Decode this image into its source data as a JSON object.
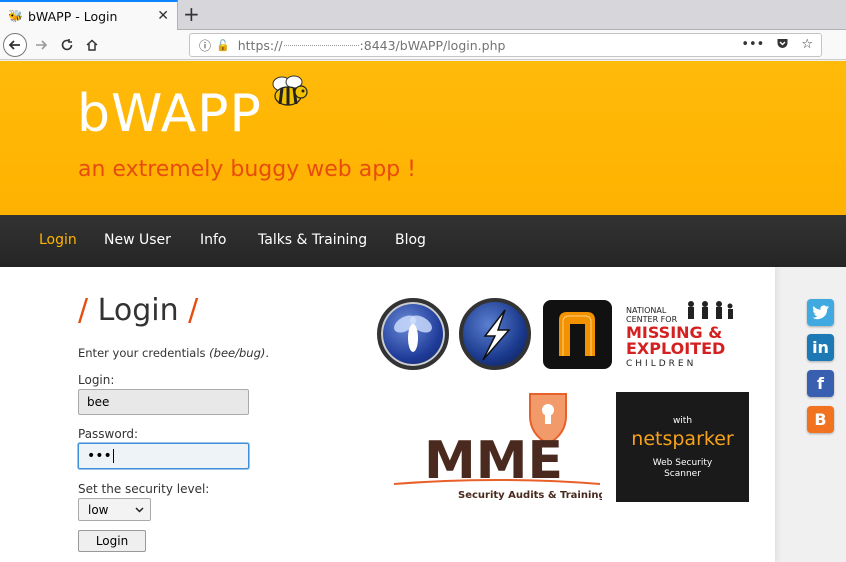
{
  "browser": {
    "tab_title": "bWAPP - Login",
    "url_prefix": "https://",
    "url_suffix": ":8443/bWAPP/login.php"
  },
  "header": {
    "logo": "bWAPP",
    "tagline": "an extremely buggy web app !"
  },
  "menu": [
    {
      "label": "Login",
      "active": true
    },
    {
      "label": "New User",
      "active": false
    },
    {
      "label": "Info",
      "active": false
    },
    {
      "label": "Talks & Training",
      "active": false
    },
    {
      "label": "Blog",
      "active": false
    }
  ],
  "login": {
    "title": "Login",
    "title_slash": "/",
    "credentials_text": "Enter your credentials ",
    "credentials_hint": "(bee/bug)",
    "credentials_end": ".",
    "login_label": "Login:",
    "login_value": "bee",
    "password_label": "Password:",
    "password_value": "•••",
    "security_label": "Set the security level:",
    "security_value": "low",
    "button_label": "Login"
  },
  "sponsors": {
    "ncmec_line1": "NATIONAL",
    "ncmec_line2": "CENTER FOR",
    "ncmec_line3": "MISSING &",
    "ncmec_line4": "EXPLOITED",
    "ncmec_line5": "CHILDREN",
    "mme_name": "MME",
    "mme_tag": "Security Audits & Training",
    "netsparker_with": "with",
    "netsparker_name": "netsparker",
    "netsparker_sub1": "Web Security",
    "netsparker_sub2": "Scanner"
  },
  "social": {
    "linkedin": "in",
    "facebook": "f",
    "blogger": "B"
  },
  "colors": {
    "accent_orange": "#ffb400",
    "tagline_red": "#e74c0f"
  }
}
